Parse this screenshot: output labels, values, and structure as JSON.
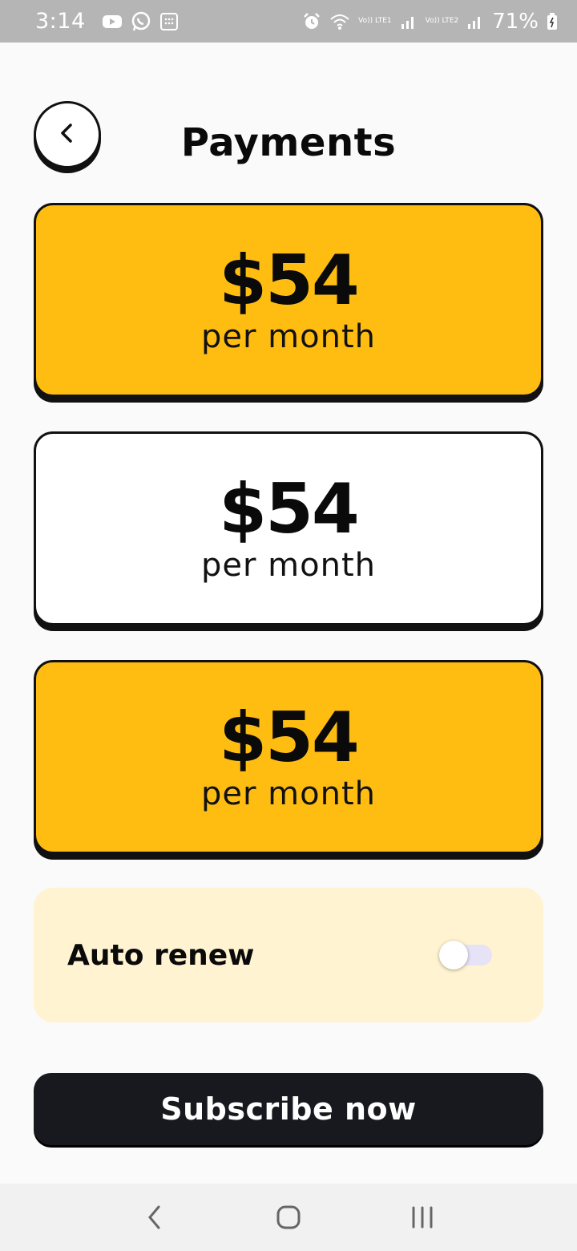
{
  "status_bar": {
    "time": "3:14",
    "net1": "Vo)) LTE1",
    "net2": "Vo)) LTE2",
    "battery_pct": "71%",
    "icons": [
      "youtube-icon",
      "whatsapp-icon",
      "calculator-icon",
      "alarm-icon",
      "wifi-icon",
      "signal-icon",
      "battery-icon"
    ]
  },
  "header": {
    "title": "Payments",
    "back_icon": "chevron-left-icon"
  },
  "plans": [
    {
      "price": "$54",
      "period": "per month",
      "color": "#ffbd12"
    },
    {
      "price": "$54",
      "period": "per month",
      "color": "#ffffff"
    },
    {
      "price": "$54",
      "period": "per month",
      "color": "#ffbd12"
    }
  ],
  "auto_renew": {
    "label": "Auto renew",
    "enabled": false,
    "panel_color": "#fff3d1"
  },
  "subscribe": {
    "label": "Subscribe now",
    "color": "#18191f"
  },
  "nav": {
    "icons": [
      "back-nav-icon",
      "home-nav-icon",
      "recents-nav-icon"
    ]
  }
}
